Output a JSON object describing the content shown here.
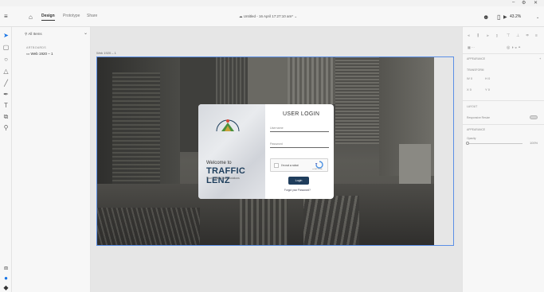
{
  "window": {
    "minimize": "–",
    "settings_glyph": "⚙",
    "close": "✕"
  },
  "menubar": {
    "home_glyph": "⌂",
    "tabs": [
      {
        "label": "Design",
        "active": true
      },
      {
        "label": "Prototype",
        "active": false
      },
      {
        "label": "Share",
        "active": false
      }
    ],
    "document_title": "Untitled - 16 April 17:27:10 am*",
    "play_glyph": "▶",
    "zoom": "43.2%"
  },
  "tools": [
    {
      "name": "select",
      "glyph": "➤",
      "selected": true
    },
    {
      "name": "rectangle",
      "glyph": "▢"
    },
    {
      "name": "ellipse",
      "glyph": "○"
    },
    {
      "name": "triangle",
      "glyph": "△"
    },
    {
      "name": "line",
      "glyph": "╱"
    },
    {
      "name": "pen",
      "glyph": "✒"
    },
    {
      "name": "text",
      "glyph": "T"
    },
    {
      "name": "artboard",
      "glyph": "⧉"
    },
    {
      "name": "zoom",
      "glyph": "⚲"
    }
  ],
  "bottom_tools": [
    {
      "name": "plugins",
      "glyph": "⧈"
    },
    {
      "name": "assets",
      "glyph": "●"
    },
    {
      "name": "layers",
      "glyph": "◆"
    }
  ],
  "layers": {
    "search_label": "All Items",
    "section_header": "ARTBOARDS",
    "artboards": [
      {
        "label": "Web 1920 – 1"
      }
    ]
  },
  "canvas": {
    "artboard_label": "Web 1920 – 1"
  },
  "login": {
    "logo_text": "TRAFFIC LENZ",
    "welcome": "Welcome to",
    "brand": "TRAFFIC LENZ",
    "tagline": "Your Traffic Clean Solutions",
    "heading": "USER LOGIN",
    "username_placeholder": "Username",
    "password_placeholder": "Password",
    "captcha_label": "I'm not a robot",
    "captcha_brand": "reCAPTCHA",
    "login_button": "Login",
    "forgot_link": "Forgot your Password?"
  },
  "inspector": {
    "section_appearance": "APPEARANCE",
    "transform_label": "TRANSFORM",
    "w_label": "W 0",
    "h_label": "H 0",
    "x_label": "X 0",
    "y_label": "Y 0",
    "grid_label": "Grid toggle",
    "layout_label": "LAYOUT",
    "responsive_resize": "Responsive Resize",
    "appearance_label": "APPEARANCE",
    "opacity_label": "Opacity",
    "opacity_value": "100%"
  },
  "colors": {
    "accent": "#1473e6",
    "brand_navy": "#1e3e5c",
    "selection": "#5b8fe6"
  }
}
